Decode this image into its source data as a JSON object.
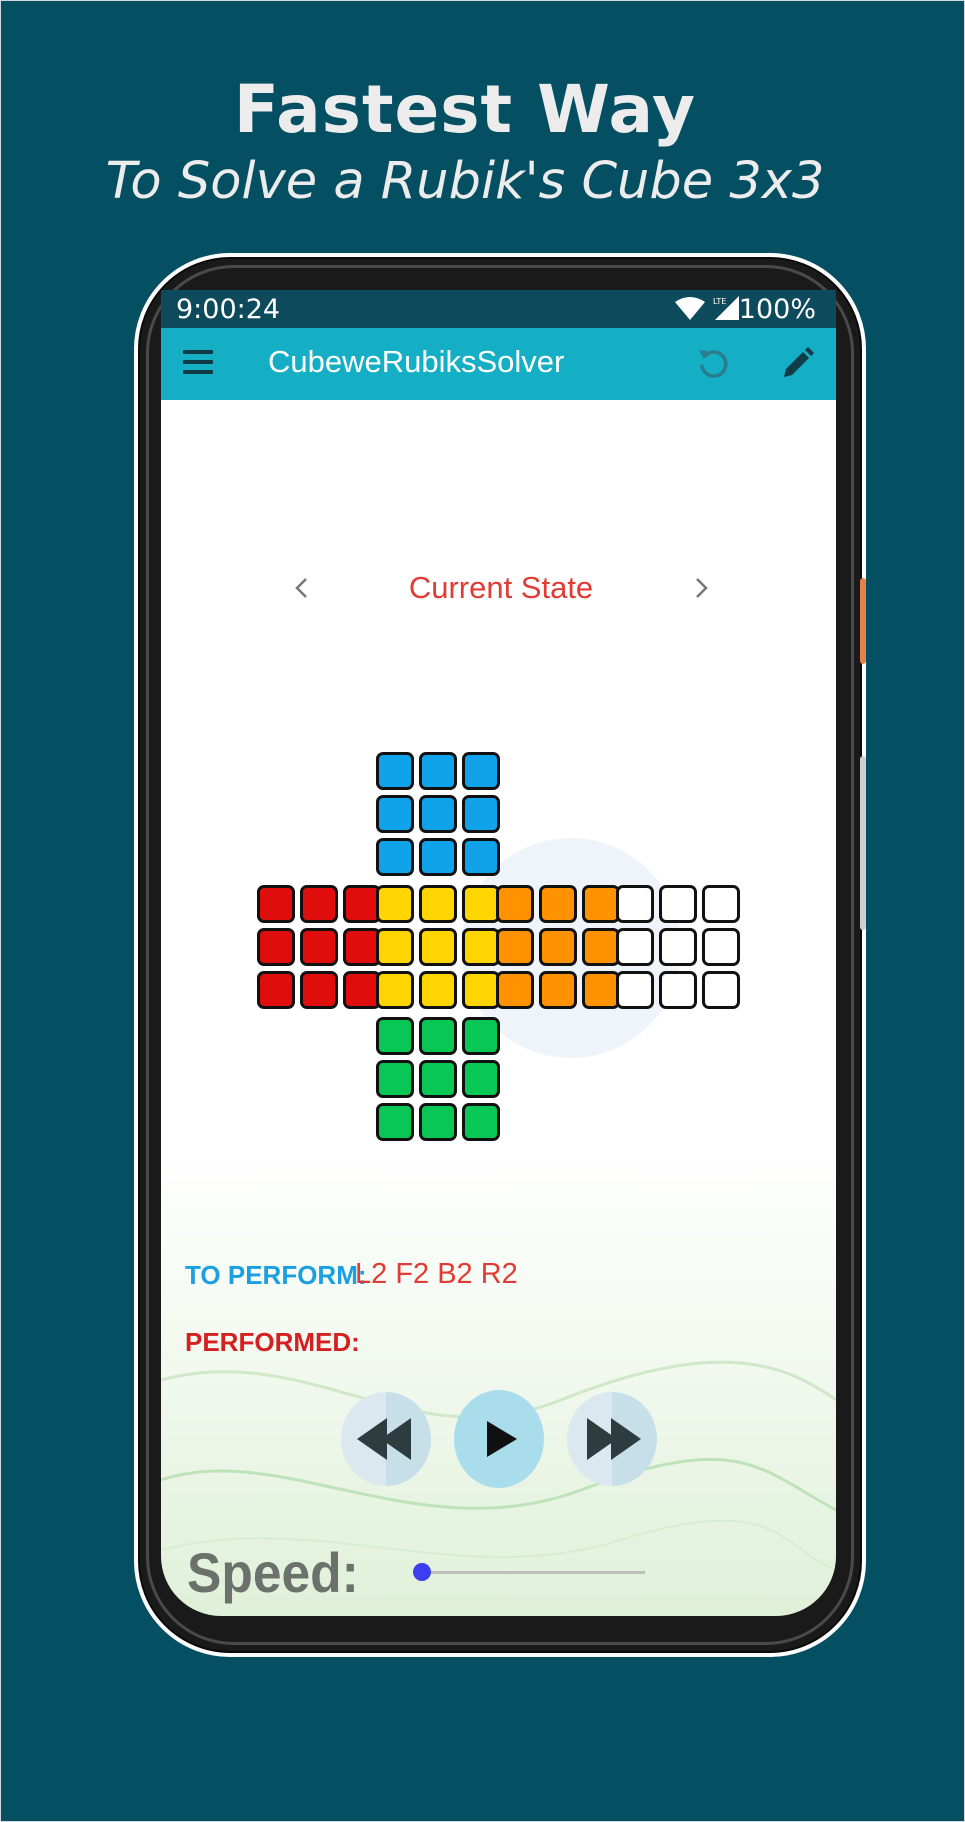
{
  "promo": {
    "headline": "Fastest Way",
    "subheadline": "To Solve a Rubik's Cube 3x3"
  },
  "statusbar": {
    "time": "9:00:24",
    "battery": "100%",
    "icons": [
      "wifi-icon",
      "lte-signal-icon"
    ]
  },
  "appbar": {
    "title": "CubeweRubiksSolver",
    "icons": [
      "hamburger-menu-icon",
      "undo-icon",
      "edit-pencil-icon"
    ]
  },
  "state": {
    "title": "Current State",
    "prev_icon": "chevron-left-icon",
    "next_icon": "chevron-right-icon"
  },
  "colors": {
    "blue": "#11a3ea",
    "red": "#e00d0d",
    "yellow": "#ffd500",
    "orange": "#ff9200",
    "white": "#ffffff",
    "green": "#08c755"
  },
  "cube": {
    "up": [
      "blue",
      "blue",
      "blue",
      "blue",
      "blue",
      "blue",
      "blue",
      "blue",
      "blue"
    ],
    "left": [
      "red",
      "red",
      "red",
      "red",
      "red",
      "red",
      "red",
      "red",
      "red"
    ],
    "front": [
      "yellow",
      "yellow",
      "yellow",
      "yellow",
      "yellow",
      "yellow",
      "yellow",
      "yellow",
      "yellow"
    ],
    "right": [
      "orange",
      "orange",
      "orange",
      "orange",
      "orange",
      "orange",
      "orange",
      "orange",
      "orange"
    ],
    "back": [
      "white",
      "white",
      "white",
      "white",
      "white",
      "white",
      "white",
      "white",
      "white"
    ],
    "down": [
      "green",
      "green",
      "green",
      "green",
      "green",
      "green",
      "green",
      "green",
      "green"
    ]
  },
  "moves": {
    "to_perform_label": "TO PERFORM:",
    "to_perform_value": "L2 F2 B2 R2",
    "performed_label": "PERFORMED:",
    "performed_value": ""
  },
  "controls": {
    "icons": [
      "rewind-icon",
      "play-icon",
      "fast-forward-icon"
    ]
  },
  "speed": {
    "label": "Speed:",
    "value": 0
  }
}
